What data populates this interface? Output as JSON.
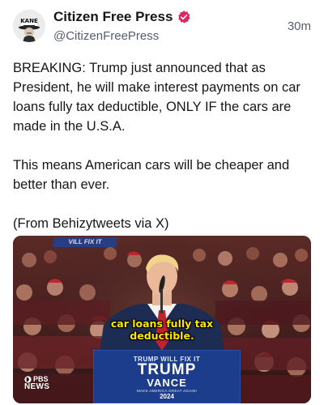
{
  "author": {
    "display_name": "Citizen Free Press",
    "handle": "@CitizenFreePress",
    "avatar_text": "KANE",
    "verified": true,
    "verified_color": "#e0245e"
  },
  "timestamp": "30m",
  "post": {
    "paragraphs": [
      "BREAKING: Trump just announced that as President, he will make interest payments on car loans fully tax deductible, ONLY IF the cars are made in the U.S.A.",
      "This means American cars will be cheaper and better than ever.",
      "(From Behizytweets via X)"
    ]
  },
  "media": {
    "caption_line1": "car loans fully tax",
    "caption_line2": "deductible.",
    "caption_color": "#ffe600",
    "podium": {
      "banner": "TRUMP WILL FIX IT",
      "name1": "TRUMP",
      "name2": "VANCE",
      "slogan": "MAKE AMERICA GREAT AGAIN!",
      "year": "2024"
    },
    "background_sign": "VILL FIX IT",
    "network_logo_top": "PBS",
    "network_logo_bottom": "NEWS"
  }
}
